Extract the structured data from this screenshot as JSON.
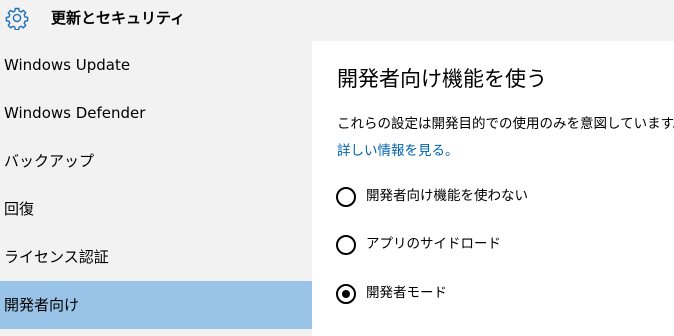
{
  "header": {
    "icon": "gear-icon",
    "title": "更新とセキュリティ"
  },
  "sidebar": {
    "items": [
      {
        "label": "Windows Update",
        "selected": false
      },
      {
        "label": "Windows Defender",
        "selected": false
      },
      {
        "label": "バックアップ",
        "selected": false
      },
      {
        "label": "回復",
        "selected": false
      },
      {
        "label": "ライセンス認証",
        "selected": false
      },
      {
        "label": "開発者向け",
        "selected": true
      }
    ],
    "selected_color": "#99c4e8"
  },
  "main": {
    "title": "開発者向け機能を使う",
    "description": "これらの設定は開発目的での使用のみを意図しています。",
    "more_link": "詳しい情報を見る。",
    "link_color": "#0063b1",
    "options": [
      {
        "label": "開発者向け機能を使わない",
        "checked": false
      },
      {
        "label": "アプリのサイドロード",
        "checked": false
      },
      {
        "label": "開発者モード",
        "checked": true
      }
    ]
  }
}
